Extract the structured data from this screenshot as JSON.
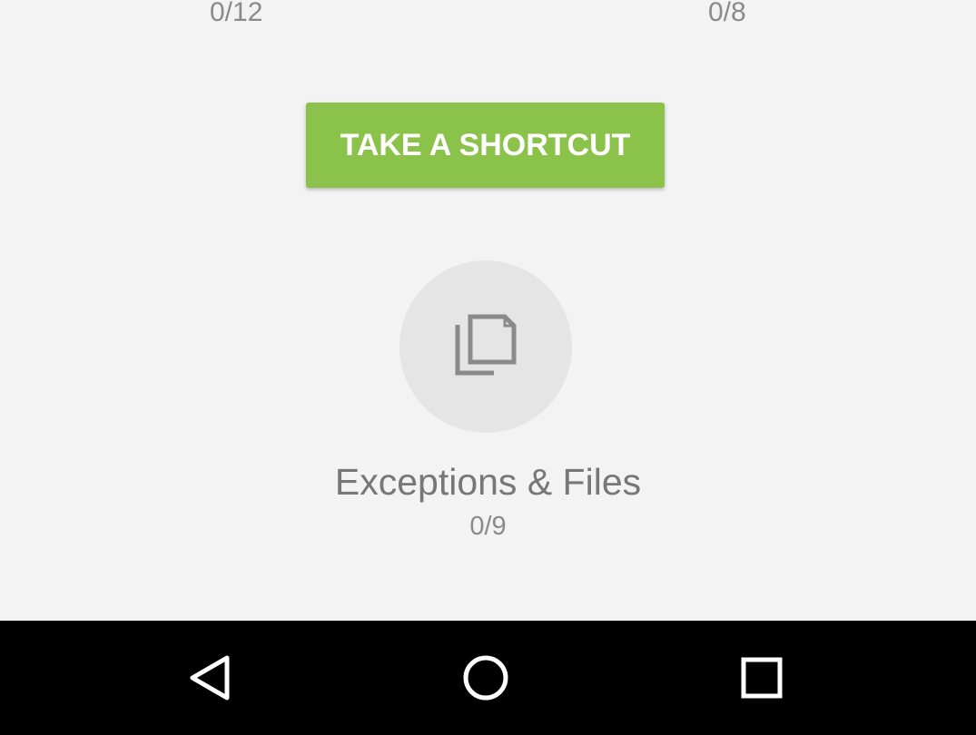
{
  "top_progress": {
    "left": "0/12",
    "right": "0/8"
  },
  "shortcut": {
    "label": "TAKE A SHORTCUT",
    "color": "#8bc34a"
  },
  "lesson": {
    "icon": "copy-files-icon",
    "title": "Exceptions & Files",
    "progress": "0/9"
  },
  "nav": {
    "back_icon": "back-triangle-icon",
    "home_icon": "home-circle-icon",
    "recents_icon": "recents-square-icon"
  }
}
